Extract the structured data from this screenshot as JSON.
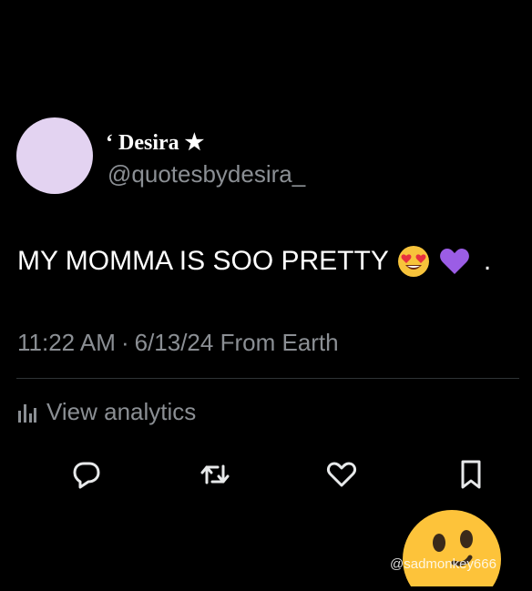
{
  "tweet": {
    "author": {
      "display_name": "‘ Desira ★",
      "handle": "@quotesbydesira_",
      "avatar_color": "#e3d3f1"
    },
    "text": "MY MOMMA IS SOO PRETTY",
    "emojis": [
      "heart-eyes-emoji",
      "purple-heart-emoji"
    ],
    "text_trailing": ".",
    "time": "11:22 AM",
    "separator": "·",
    "date": "6/13/24",
    "source": "From Earth",
    "analytics_label": "View analytics"
  },
  "actions": {
    "icons": [
      "reply-icon",
      "retweet-icon",
      "like-icon",
      "bookmark-icon"
    ]
  },
  "watermark": {
    "text": "@sadmonkey666",
    "icon": "smiley-sticker"
  },
  "colors": {
    "background": "#000000",
    "text_primary": "#ffffff",
    "text_secondary": "#8b8f94",
    "divider": "#2f3336"
  }
}
